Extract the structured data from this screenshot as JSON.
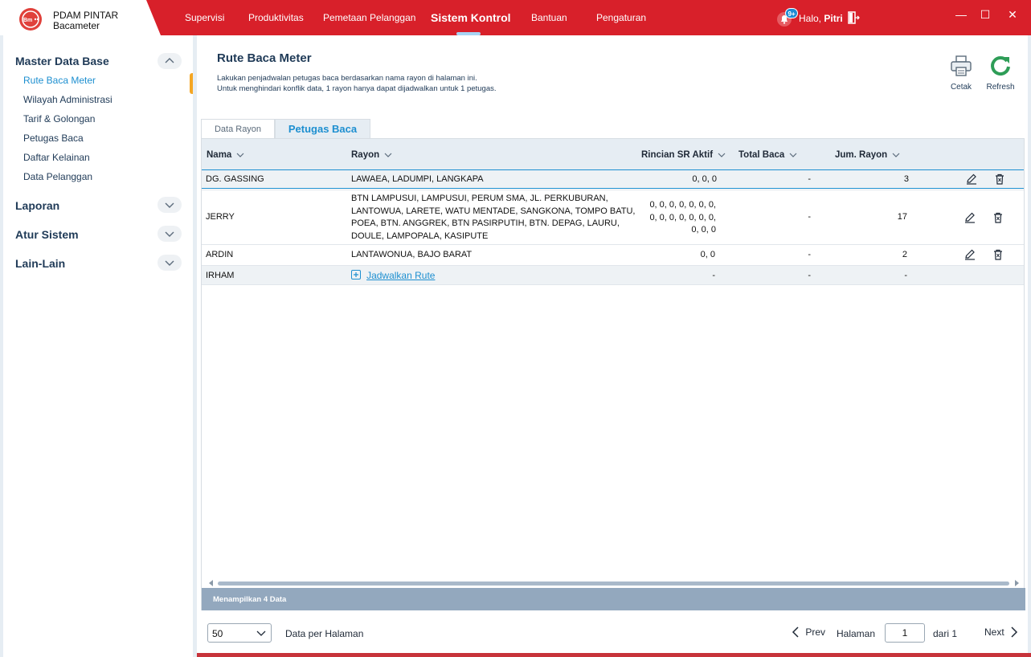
{
  "app": {
    "name_line1": "PDAM PINTAR",
    "name_line2": "Bacameter",
    "logo_text": "Bm"
  },
  "nav": {
    "items": [
      "Supervisi",
      "Produktivitas",
      "Pemetaan Pelanggan",
      "Sistem Kontrol",
      "Bantuan",
      "Pengaturan"
    ],
    "active": "Sistem Kontrol"
  },
  "user": {
    "notif_badge": "9+",
    "greeting": "Halo,",
    "name": "Pitri"
  },
  "window": {
    "minimize": "—",
    "maximize": "☐",
    "close": "✕"
  },
  "sidebar": {
    "sections": [
      {
        "title": "Master Data Base",
        "expanded": true,
        "items": [
          "Rute Baca Meter",
          "Wilayah Administrasi",
          "Tarif & Golongan",
          "Petugas Baca",
          "Daftar Kelainan",
          "Data Pelanggan"
        ]
      },
      {
        "title": "Laporan",
        "expanded": false
      },
      {
        "title": "Atur Sistem",
        "expanded": false
      },
      {
        "title": "Lain-Lain",
        "expanded": false
      }
    ],
    "active_item": "Rute Baca Meter"
  },
  "page": {
    "title": "Rute Baca Meter",
    "desc1": "Lakukan penjadwalan petugas baca berdasarkan nama rayon di halaman ini.",
    "desc2": "Untuk menghindari konflik data, 1 rayon hanya dapat dijadwalkan untuk 1 petugas.",
    "print_label": "Cetak",
    "refresh_label": "Refresh"
  },
  "tabs": {
    "items": [
      "Data Rayon",
      "Petugas Baca"
    ],
    "active": "Petugas Baca"
  },
  "table": {
    "columns": [
      "Nama",
      "Rayon",
      "Rincian SR Aktif",
      "Total Baca",
      "Jum. Rayon"
    ],
    "rows": [
      {
        "nama": "DG. GASSING",
        "rayon": "LAWAEA, LADUMPI, LANGKAPA",
        "rincian": "0, 0, 0",
        "total": "-",
        "jum": "3"
      },
      {
        "nama": "JERRY",
        "rayon_lines": [
          "BTN LAMPUSUI, LAMPUSUI, PERUM SMA, JL. PERKUBURAN,",
          "LANTOWUA, LARETE, WATU MENTADE, SANGKONA, TOMPO BATU,",
          "POEA, BTN. ANGGREK, BTN PASIRPUTIH, BTN. DEPAG, LAURU,",
          "DOULE, LAMPOPALA, KASIPUTE"
        ],
        "rincian_lines": [
          "0, 0, 0, 0, 0, 0, 0,",
          "0, 0, 0, 0, 0, 0, 0,",
          "0, 0, 0"
        ],
        "total": "-",
        "jum": "17"
      },
      {
        "nama": "ARDIN",
        "rayon": "LANTAWONUA, BAJO BARAT",
        "rincian": "0, 0",
        "total": "-",
        "jum": "2"
      },
      {
        "nama": "IRHAM",
        "schedule_link": "Jadwalkan Rute",
        "rincian": "-",
        "total": "-",
        "jum": "-"
      }
    ],
    "footer": "Menampilkan 4 Data"
  },
  "pager": {
    "page_size": "50",
    "per_page_label": "Data per Halaman",
    "prev": "Prev",
    "page_label": "Halaman",
    "page_value": "1",
    "of_label": "dari 1",
    "next": "Next"
  },
  "colors": {
    "brand_red": "#d8202a",
    "accent_blue": "#1d8fd0",
    "accent_orange": "#f5a623",
    "refresh_green": "#2e9d57"
  }
}
